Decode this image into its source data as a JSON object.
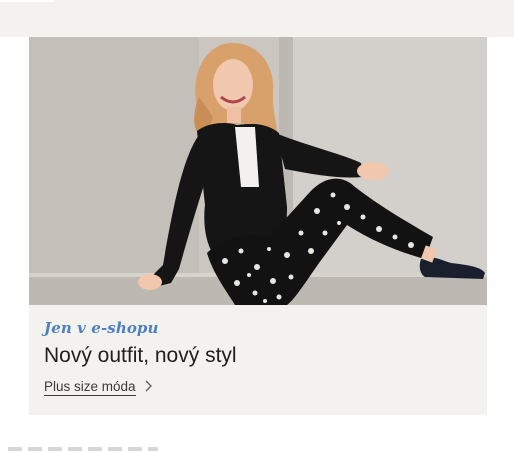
{
  "promo": {
    "eyebrow": "Jen v e-shopu",
    "headline": "Nový outfit, nový styl",
    "cta_label": "Plus size móda"
  },
  "colors": {
    "band_background": "#f4f2ee",
    "eyebrow": "#4f7fbf",
    "headline": "#1f1f1f",
    "photo_wall": "#c8c3bd"
  },
  "icons": {
    "cta_arrow": "chevron-right-icon"
  }
}
